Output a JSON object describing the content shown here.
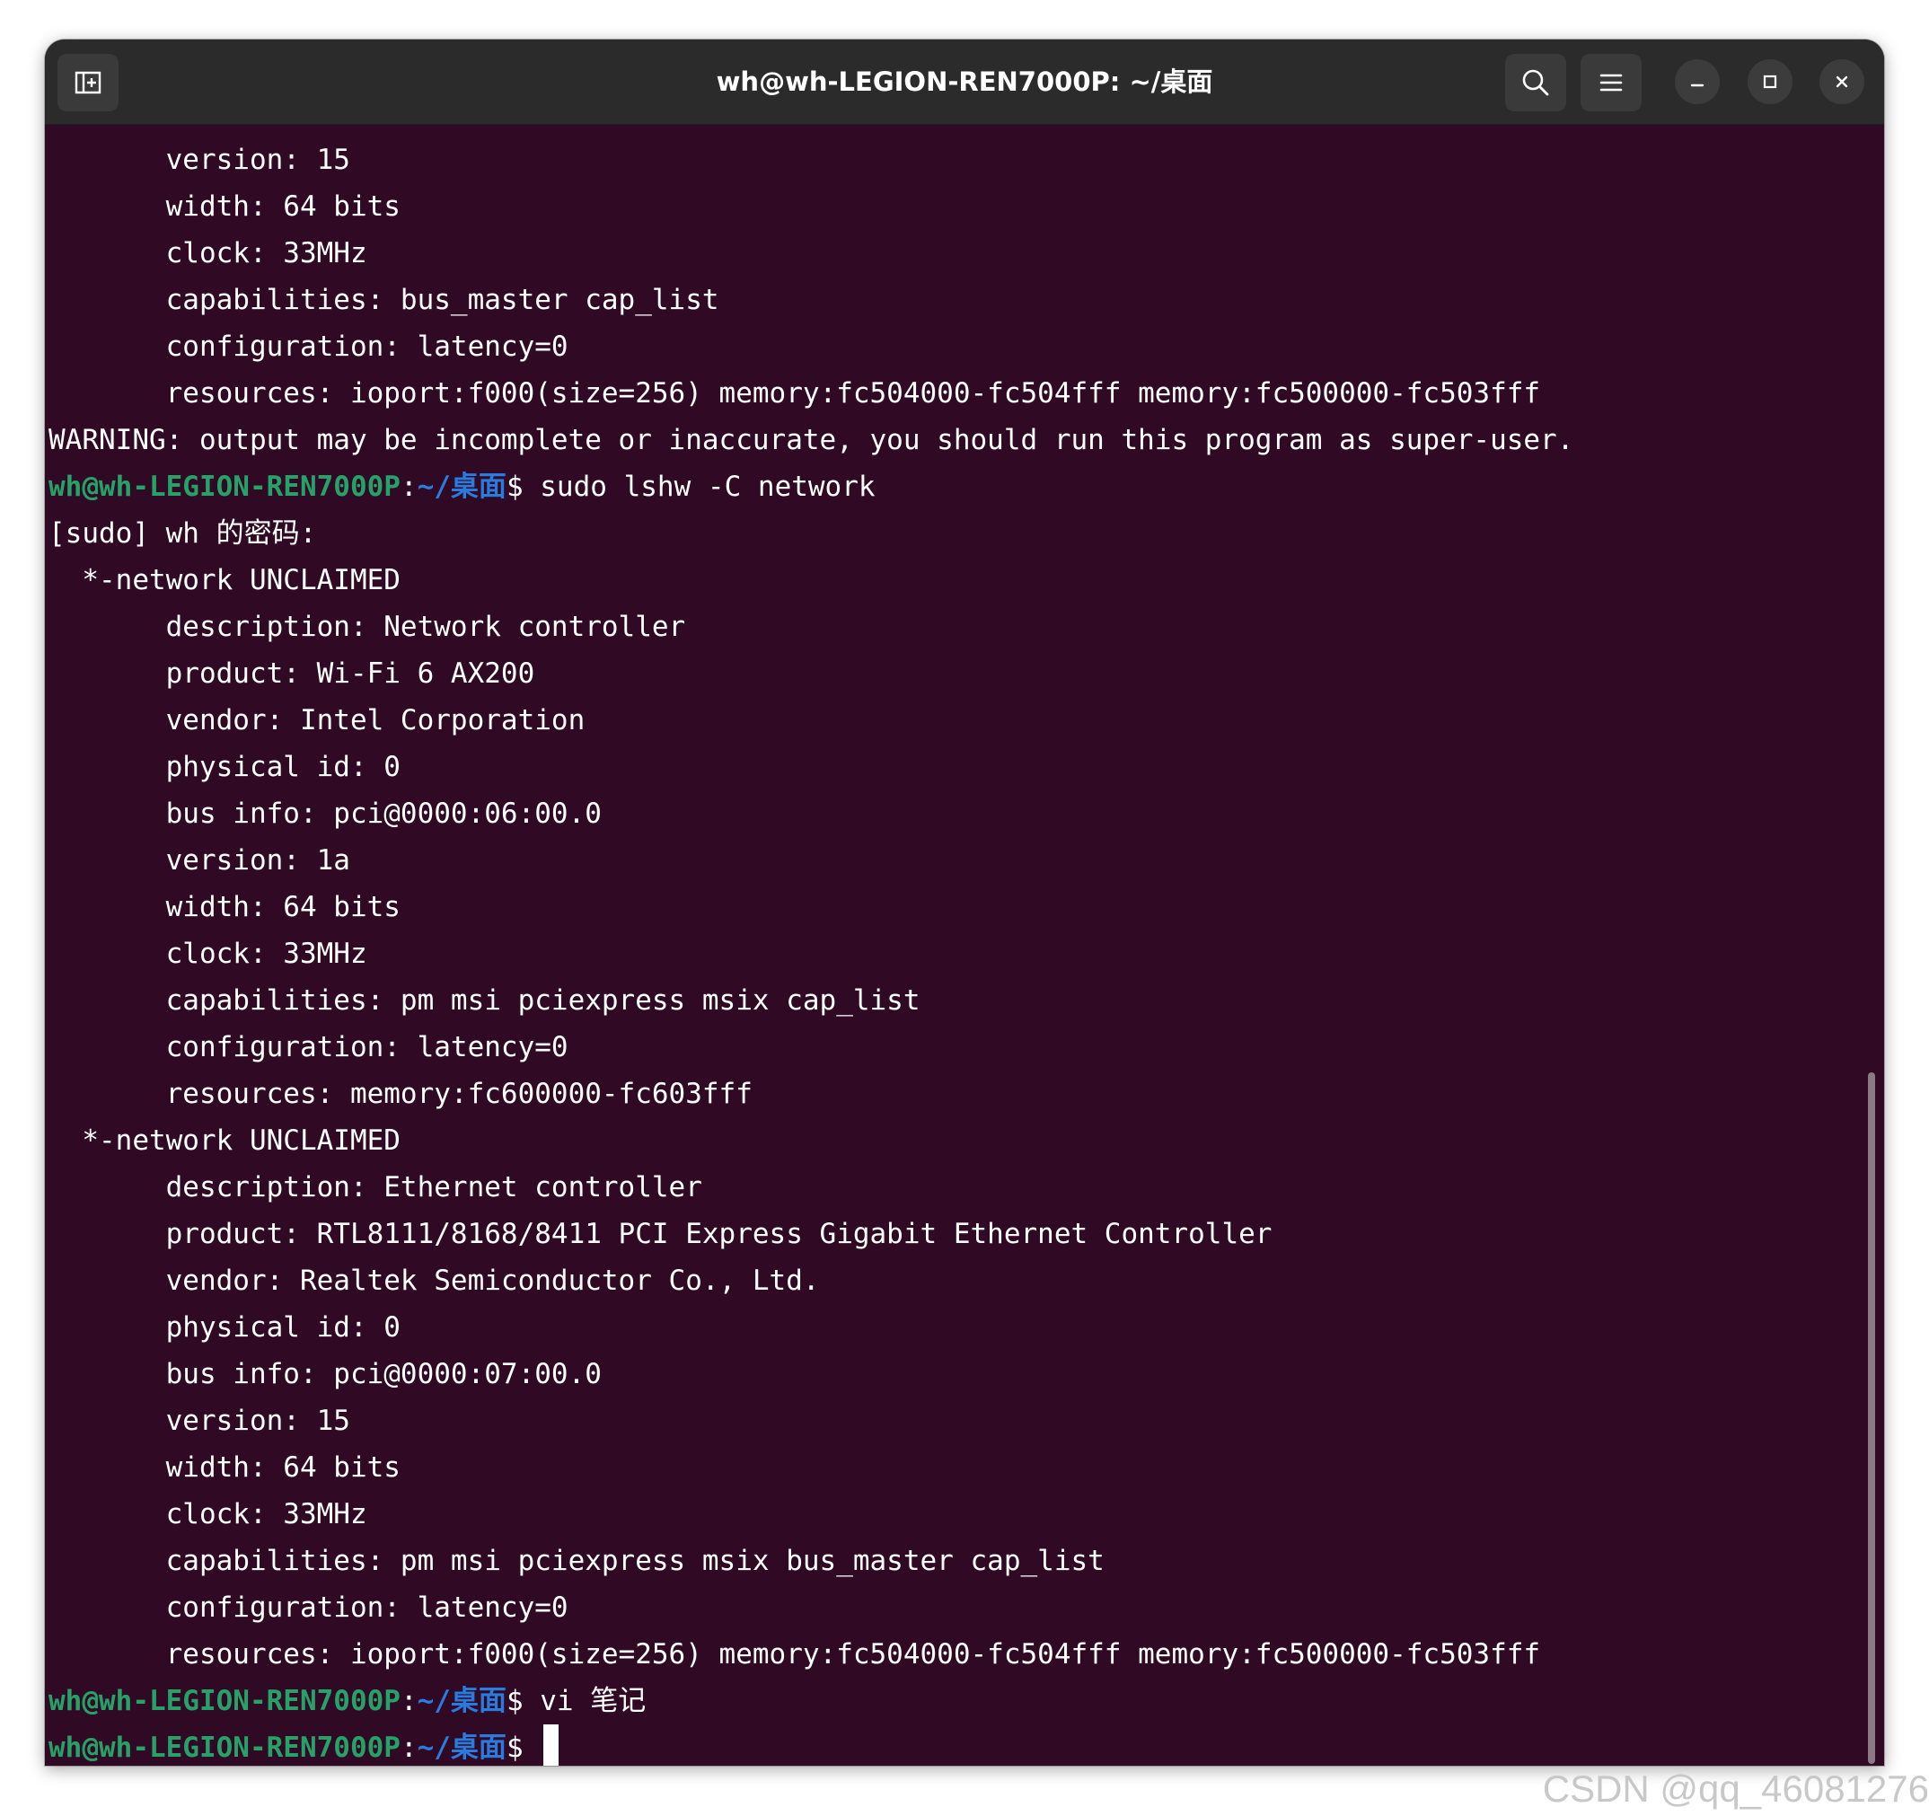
{
  "window": {
    "title": "wh@wh-LEGION-REN7000P: ~/桌面"
  },
  "titlebar": {
    "new_tab_icon": "new-tab-icon",
    "search_icon": "search-icon",
    "menu_icon": "hamburger-menu-icon",
    "minimize_icon": "minimize-icon",
    "maximize_icon": "maximize-icon",
    "close_icon": "close-icon"
  },
  "colors": {
    "terminal_bg": "#300a24",
    "titlebar_bg": "#2b2b2b",
    "prompt_user": "#26a269",
    "prompt_path": "#2a7bde",
    "text": "#ffffff"
  },
  "prompt": {
    "user_host": "wh@wh-LEGION-REN7000P",
    "colon": ":",
    "path": "~/桌面",
    "dollar": "$"
  },
  "terminal": {
    "lines": [
      {
        "type": "out",
        "text": "       version: 15"
      },
      {
        "type": "out",
        "text": "       width: 64 bits"
      },
      {
        "type": "out",
        "text": "       clock: 33MHz"
      },
      {
        "type": "out",
        "text": "       capabilities: bus_master cap_list"
      },
      {
        "type": "out",
        "text": "       configuration: latency=0"
      },
      {
        "type": "out",
        "text": "       resources: ioport:f000(size=256) memory:fc504000-fc504fff memory:fc500000-fc503fff"
      },
      {
        "type": "out",
        "text": "WARNING: output may be incomplete or inaccurate, you should run this program as super-user."
      },
      {
        "type": "prompt",
        "text": " sudo lshw -C network"
      },
      {
        "type": "out",
        "text": "[sudo] wh 的密码:"
      },
      {
        "type": "out",
        "text": "  *-network UNCLAIMED"
      },
      {
        "type": "out",
        "text": "       description: Network controller"
      },
      {
        "type": "out",
        "text": "       product: Wi-Fi 6 AX200"
      },
      {
        "type": "out",
        "text": "       vendor: Intel Corporation"
      },
      {
        "type": "out",
        "text": "       physical id: 0"
      },
      {
        "type": "out",
        "text": "       bus info: pci@0000:06:00.0"
      },
      {
        "type": "out",
        "text": "       version: 1a"
      },
      {
        "type": "out",
        "text": "       width: 64 bits"
      },
      {
        "type": "out",
        "text": "       clock: 33MHz"
      },
      {
        "type": "out",
        "text": "       capabilities: pm msi pciexpress msix cap_list"
      },
      {
        "type": "out",
        "text": "       configuration: latency=0"
      },
      {
        "type": "out",
        "text": "       resources: memory:fc600000-fc603fff"
      },
      {
        "type": "out",
        "text": "  *-network UNCLAIMED"
      },
      {
        "type": "out",
        "text": "       description: Ethernet controller"
      },
      {
        "type": "out",
        "text": "       product: RTL8111/8168/8411 PCI Express Gigabit Ethernet Controller"
      },
      {
        "type": "out",
        "text": "       vendor: Realtek Semiconductor Co., Ltd."
      },
      {
        "type": "out",
        "text": "       physical id: 0"
      },
      {
        "type": "out",
        "text": "       bus info: pci@0000:07:00.0"
      },
      {
        "type": "out",
        "text": "       version: 15"
      },
      {
        "type": "out",
        "text": "       width: 64 bits"
      },
      {
        "type": "out",
        "text": "       clock: 33MHz"
      },
      {
        "type": "out",
        "text": "       capabilities: pm msi pciexpress msix bus_master cap_list"
      },
      {
        "type": "out",
        "text": "       configuration: latency=0"
      },
      {
        "type": "out",
        "text": "       resources: ioport:f000(size=256) memory:fc504000-fc504fff memory:fc500000-fc503fff"
      },
      {
        "type": "prompt",
        "text": " vi 笔记"
      },
      {
        "type": "prompt",
        "text": " ",
        "cursor": true
      }
    ]
  },
  "watermark": "CSDN @qq_46081276"
}
